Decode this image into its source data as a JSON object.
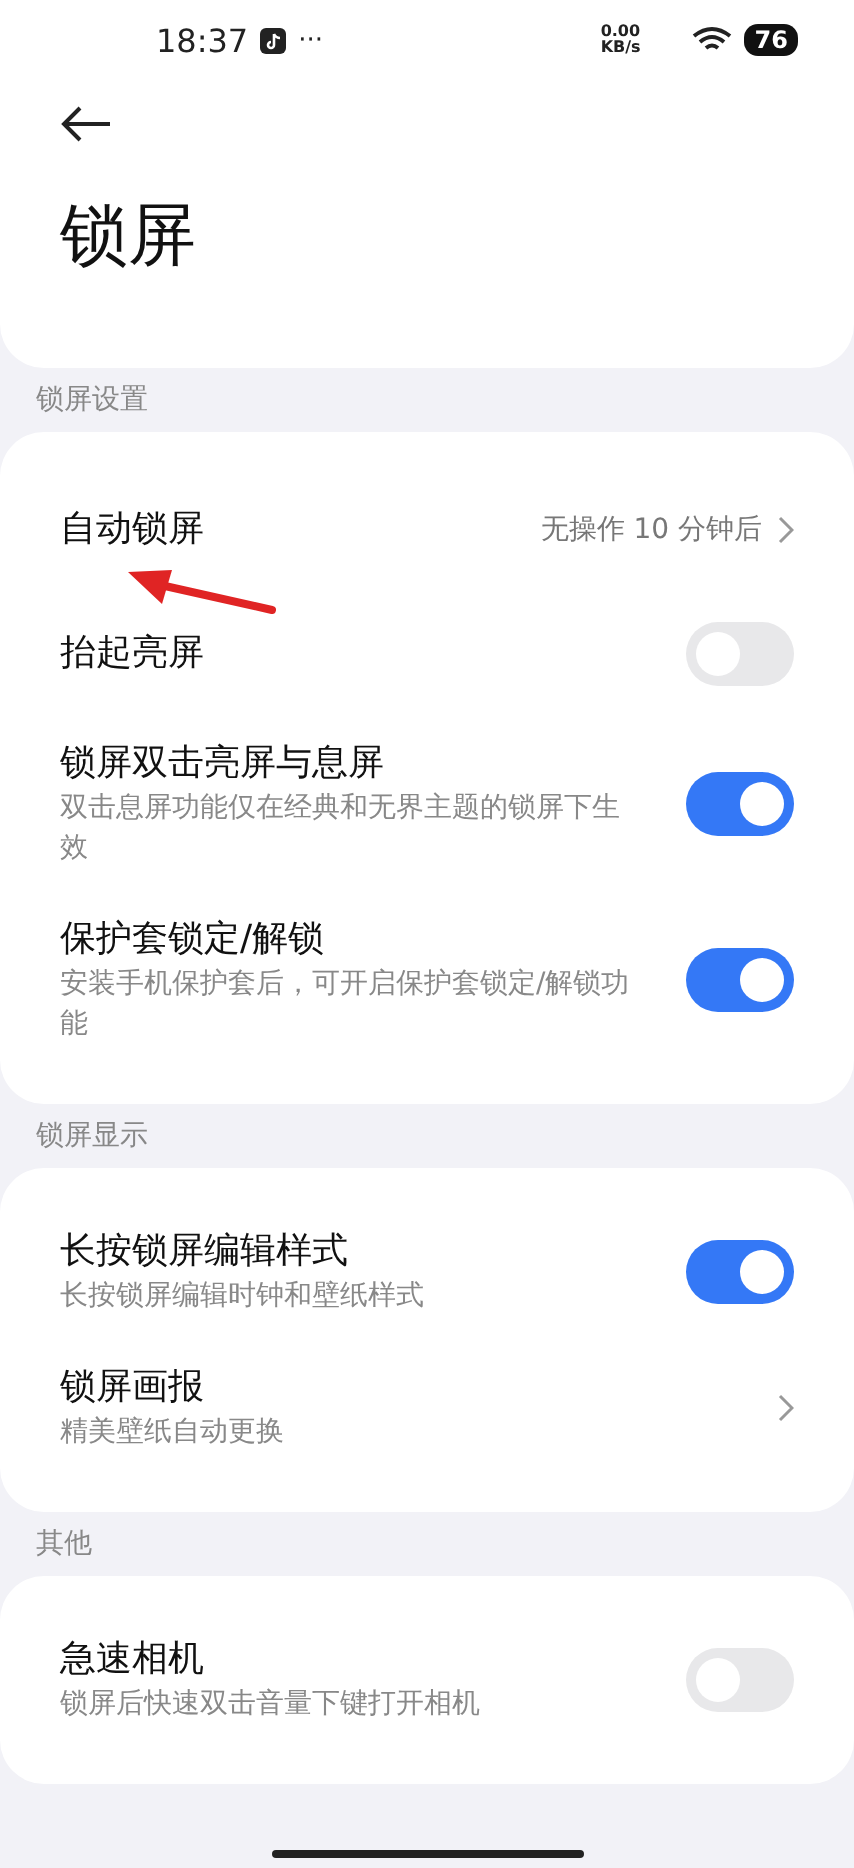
{
  "status_bar": {
    "time": "18:37",
    "more_indicator": "···",
    "net_speed_value": "0.00",
    "net_speed_unit": "KB/s",
    "battery": "76"
  },
  "header": {
    "title": "锁屏"
  },
  "sections": [
    {
      "label": "锁屏设置",
      "items": [
        {
          "kind": "value",
          "title": "自动锁屏",
          "value": "无操作 10 分钟后"
        },
        {
          "kind": "toggle",
          "title": "抬起亮屏",
          "on": false
        },
        {
          "kind": "toggle",
          "title": "锁屏双击亮屏与息屏",
          "subtitle": "双击息屏功能仅在经典和无界主题的锁屏下生效",
          "on": true
        },
        {
          "kind": "toggle",
          "title": "保护套锁定/解锁",
          "subtitle": "安装手机保护套后，可开启保护套锁定/解锁功能",
          "on": true
        }
      ]
    },
    {
      "label": "锁屏显示",
      "items": [
        {
          "kind": "toggle",
          "title": "长按锁屏编辑样式",
          "subtitle": "长按锁屏编辑时钟和壁纸样式",
          "on": true
        },
        {
          "kind": "link",
          "title": "锁屏画报",
          "subtitle": "精美壁纸自动更换"
        }
      ]
    },
    {
      "label": "其他",
      "items": [
        {
          "kind": "toggle",
          "title": "急速相机",
          "subtitle": "锁屏后快速双击音量下键打开相机",
          "on": false
        }
      ]
    }
  ]
}
